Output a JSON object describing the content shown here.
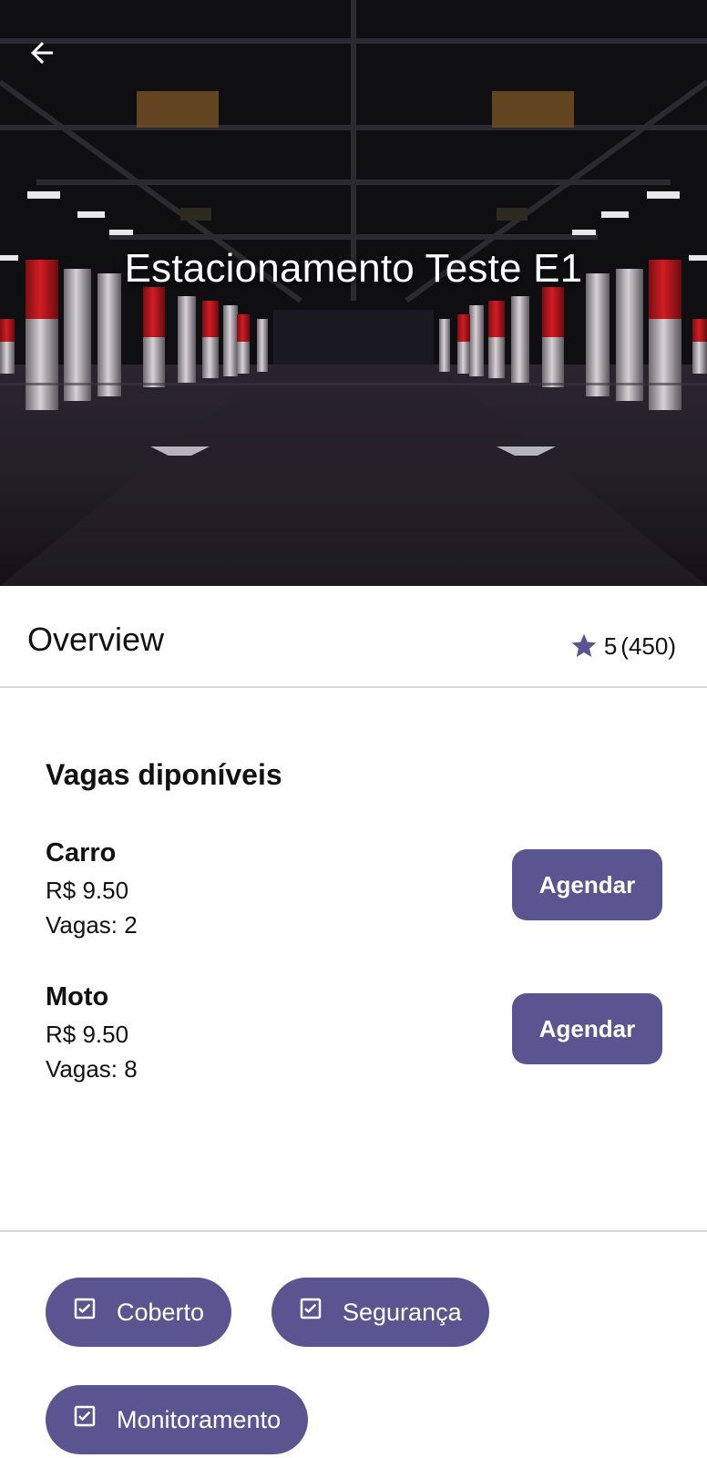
{
  "hero": {
    "title": "Estacionamento Teste E1",
    "back_icon": "arrow-left-icon"
  },
  "overview": {
    "title": "Overview",
    "rating_value": "5",
    "rating_count": "(450)",
    "star_color": "#5a5591"
  },
  "vagas": {
    "title": "Vagas diponíveis",
    "items": [
      {
        "name": "Carro",
        "price": "R$ 9.50",
        "vagas": "Vagas: 2",
        "button": "Agendar"
      },
      {
        "name": "Moto",
        "price": "R$ 9.50",
        "vagas": "Vagas: 8",
        "button": "Agendar"
      }
    ]
  },
  "features": [
    {
      "label": "Coberto",
      "icon": "checkbox-checked-icon"
    },
    {
      "label": "Segurança",
      "icon": "checkbox-checked-icon"
    },
    {
      "label": "Monitoramento",
      "icon": "checkbox-checked-icon"
    }
  ],
  "colors": {
    "accent": "#5a5591",
    "divider": "#d9d9d9"
  }
}
